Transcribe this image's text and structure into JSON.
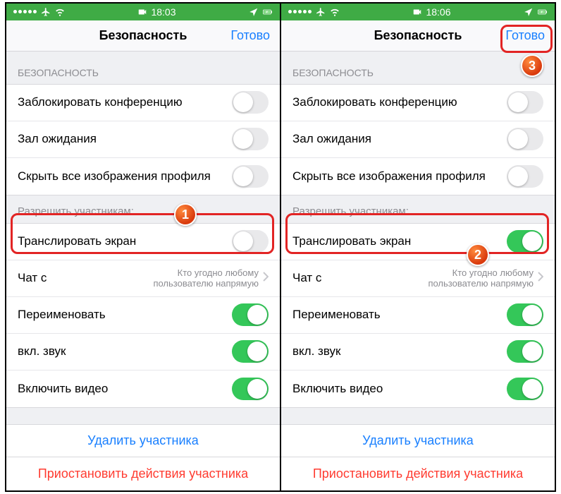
{
  "left": {
    "status": {
      "time": "18:03"
    },
    "nav": {
      "title": "Безопасность",
      "done": "Готово"
    },
    "sections": {
      "securityLabel": "БЕЗОПАСНОСТЬ",
      "allowLabel": "Разрешить участникам:"
    },
    "rows": {
      "lock": "Заблокировать конференцию",
      "waitRoom": "Зал ожидания",
      "hideProfiles": "Скрыть все изображения профиля",
      "shareScreen": "Транслировать экран",
      "chat": "Чат с",
      "chatDetail": "Кто угодно любому пользователю напрямую",
      "rename": "Переименовать",
      "unmute": "вкл. звук",
      "video": "Включить видео",
      "remove": "Удалить участника",
      "suspend": "Приостановить действия участника"
    },
    "badge": "1"
  },
  "right": {
    "status": {
      "time": "18:06"
    },
    "nav": {
      "title": "Безопасность",
      "done": "Готово"
    },
    "sections": {
      "securityLabel": "БЕЗОПАСНОСТЬ",
      "allowLabel": "Разрешить участникам:"
    },
    "rows": {
      "lock": "Заблокировать конференцию",
      "waitRoom": "Зал ожидания",
      "hideProfiles": "Скрыть все изображения профиля",
      "shareScreen": "Транслировать экран",
      "chat": "Чат с",
      "chatDetail": "Кто угодно любому пользователю напрямую",
      "rename": "Переименовать",
      "unmute": "вкл. звук",
      "video": "Включить видео",
      "remove": "Удалить участника",
      "suspend": "Приостановить действия участника"
    },
    "badge2": "2",
    "badge3": "3"
  }
}
